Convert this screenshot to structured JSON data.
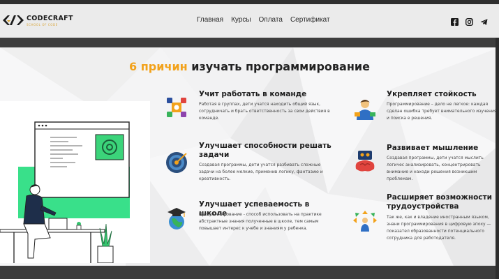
{
  "brand": {
    "name": "CODECRAFT",
    "tagline": "SCHOOL OF CODE"
  },
  "nav": {
    "items": [
      "Главная",
      "Курсы",
      "Оплата",
      "Сертификат"
    ]
  },
  "social": [
    "facebook-icon",
    "instagram-icon",
    "telegram-icon"
  ],
  "heading": {
    "accent": "6 причин",
    "rest": " изучать программирование"
  },
  "reasons": [
    {
      "title": "Учит работать в команде",
      "text": "Работая в группах, дети учатся находить общий язык, сотрудничать и брать ответственность за свои действия в команде.",
      "icon": "team-puzzle-icon"
    },
    {
      "title": "Улучшает способности решать задачи",
      "text": "Создавая программы, дети учатся разбивать сложные задачи на более мелкие, применив логику, фантазию и креативность.",
      "icon": "target-icon"
    },
    {
      "title": "Улучшает успеваемость в школе",
      "text": "Программирование - способ использовать на практике абстрактные знания полученные в школе, тем самым повышает интерес к учебе и знаниям у ребенка.",
      "icon": "graduation-globe-icon"
    },
    {
      "title": "Укрепляет стойкость",
      "text": "Программирование – дело не легкое: каждая сделан ошибка требует внимательного изучения и поиска е решения.",
      "icon": "student-icon"
    },
    {
      "title": "Развивает мышление",
      "text": "Создавая программы, дети учатся мыслить логичес анализировать, концентрировать внимание и находи решения возникшим проблемам.",
      "icon": "brain-icon"
    },
    {
      "title": "Расширяет возможности трудоустройства",
      "text": "Так же, как и владение иностранным языком, знани программирования в цифровую эпоху — показател образованности потенциального сотрудника для работодателя.",
      "icon": "career-arrows-icon"
    }
  ]
}
